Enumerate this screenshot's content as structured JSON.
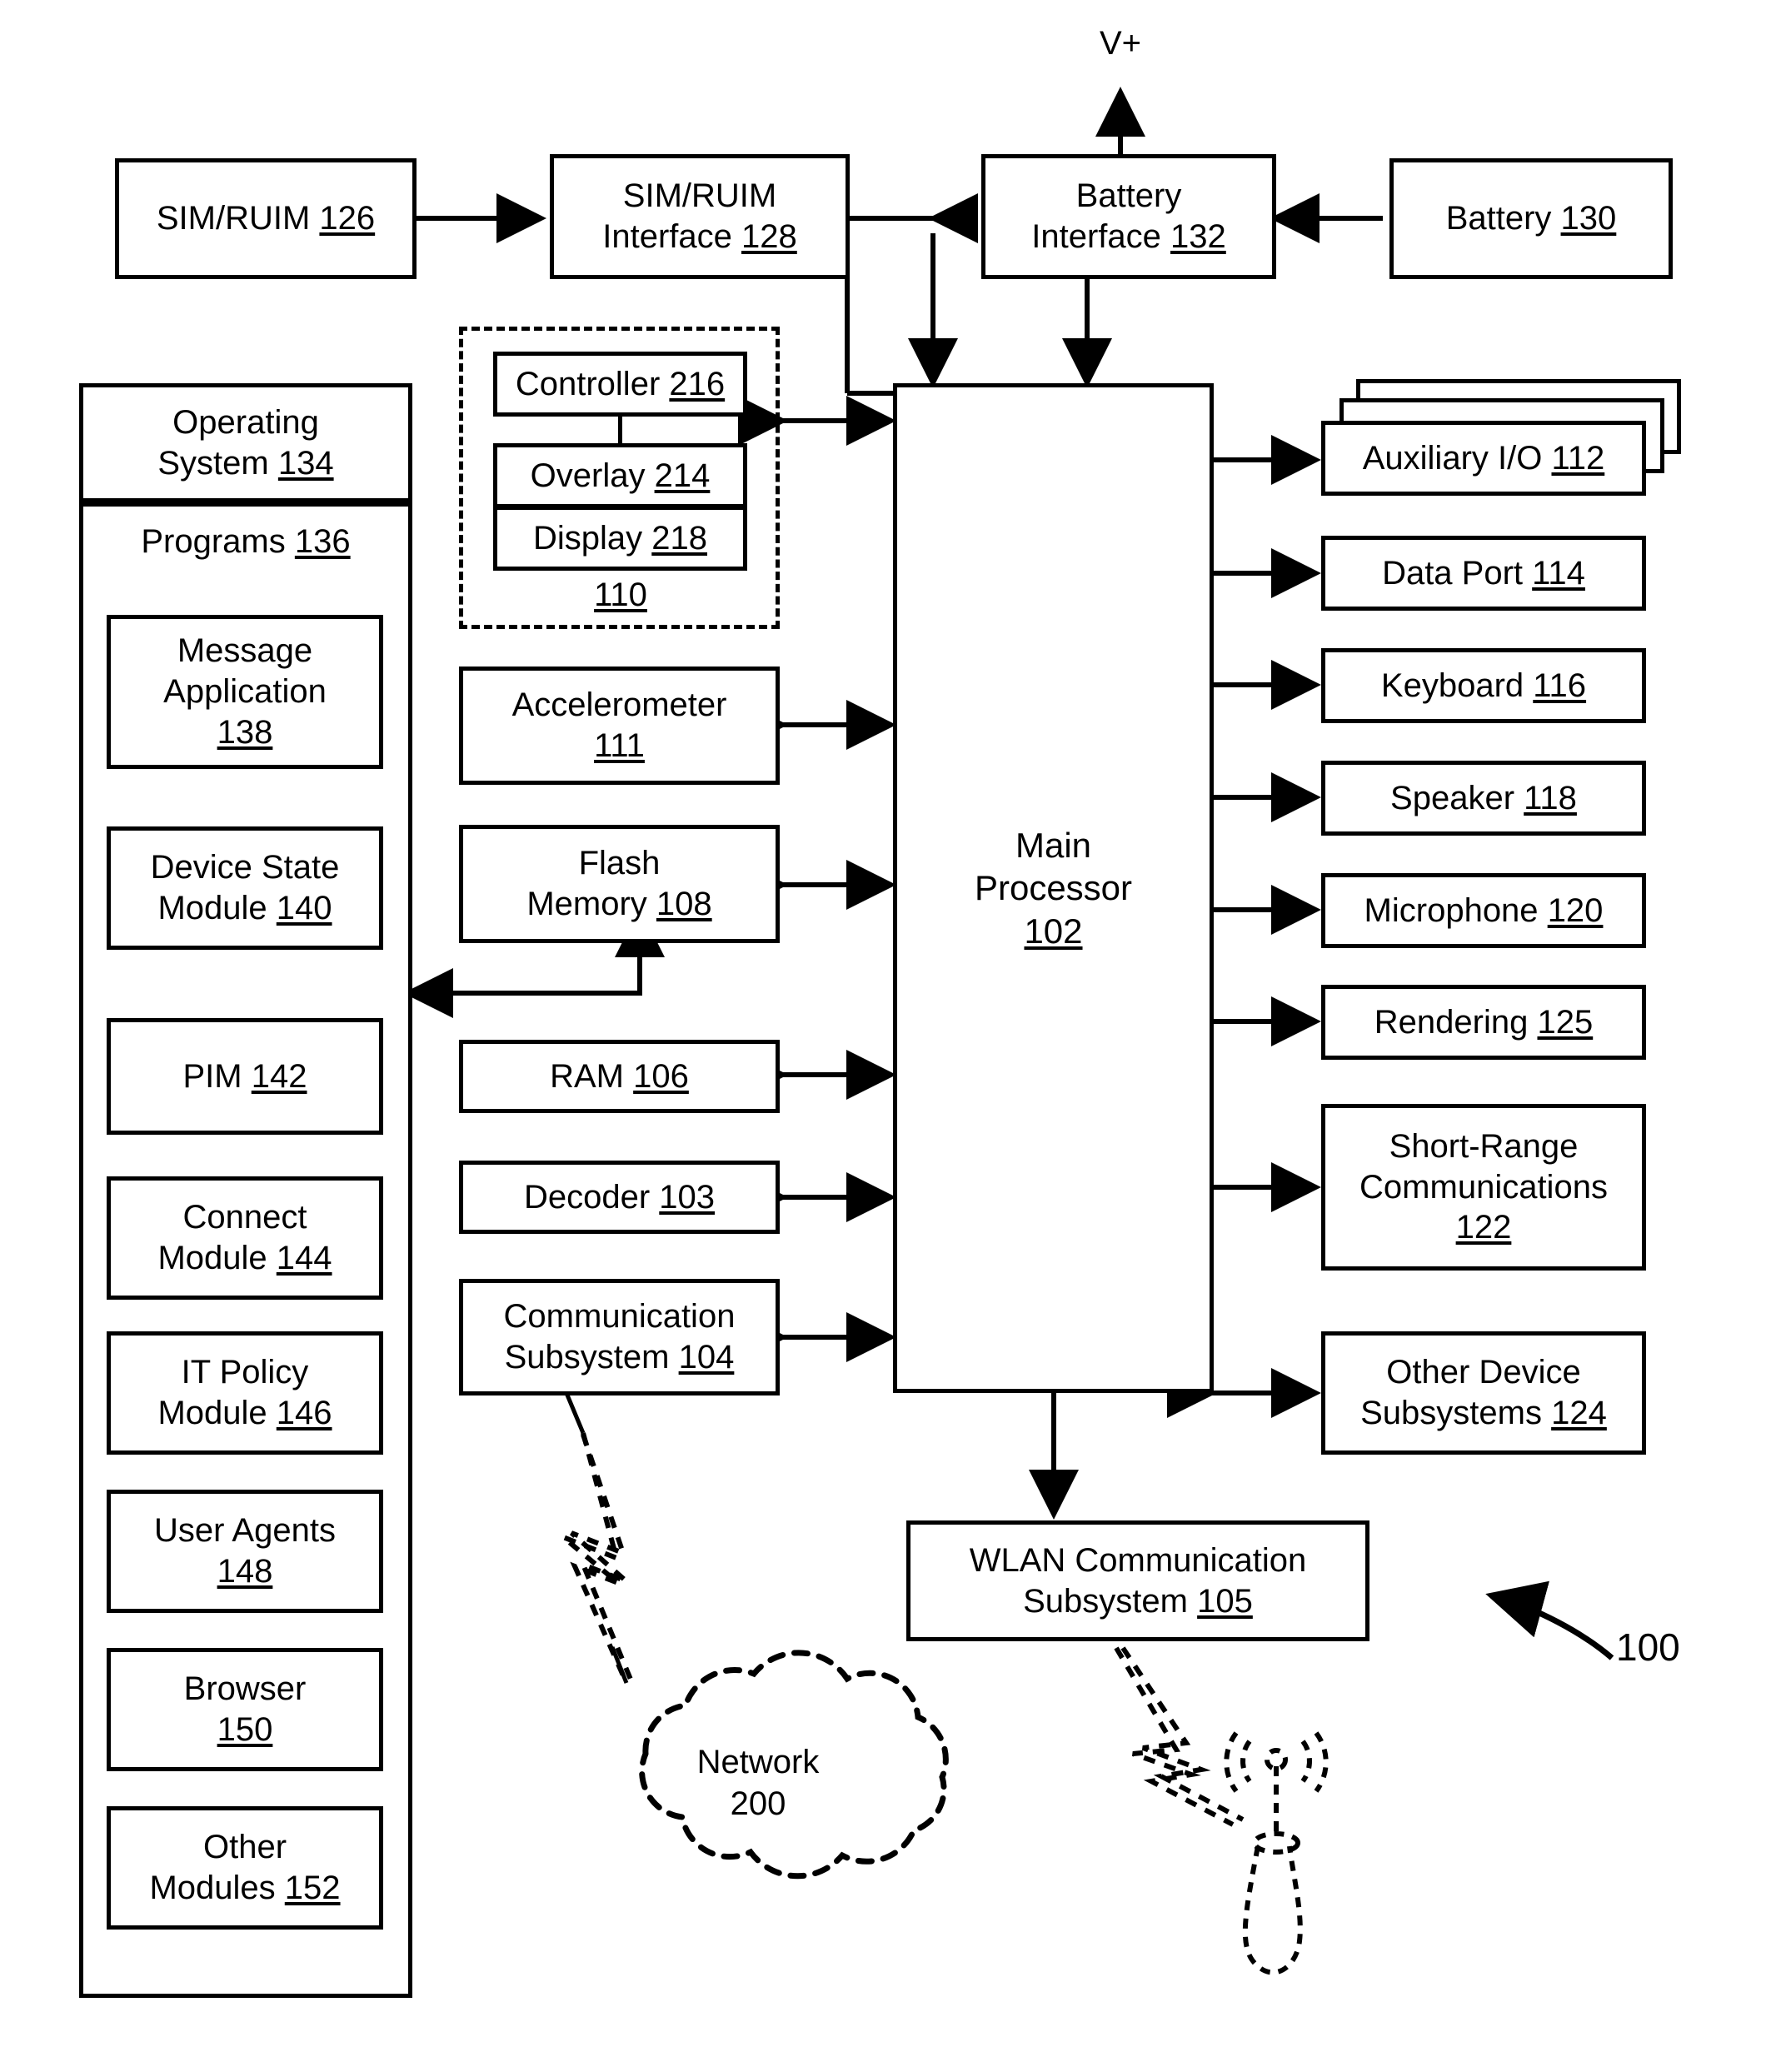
{
  "figure": {
    "reference_numeral": "100",
    "power_label": "V+"
  },
  "top_row": {
    "sim_ruim": {
      "name": "SIM/RUIM",
      "ref": "126"
    },
    "sim_ruim_interface": {
      "name": "SIM/RUIM",
      "name2": "Interface",
      "ref": "128"
    },
    "battery_interface": {
      "name": "Battery",
      "name2": "Interface",
      "ref": "132"
    },
    "battery": {
      "name": "Battery",
      "ref": "130"
    }
  },
  "software_column": {
    "operating_system": {
      "name": "Operating",
      "name2": "System",
      "ref": "134"
    },
    "programs": {
      "name": "Programs",
      "ref": "136"
    },
    "modules": [
      {
        "line1": "Message",
        "line2": "Application",
        "ref": "138",
        "lines": 2
      },
      {
        "line1": "Device State",
        "line2": "Module",
        "ref": "140",
        "lines": 1
      },
      {
        "line1": "PIM",
        "line2": "",
        "ref": "142",
        "lines": 0
      },
      {
        "line1": "Connect",
        "line2": "Module",
        "ref": "144",
        "lines": 1
      },
      {
        "line1": "IT Policy",
        "line2": "Module",
        "ref": "146",
        "lines": 1
      },
      {
        "line1": "User Agents",
        "line2": "",
        "ref": "148",
        "lines": 2
      },
      {
        "line1": "Browser",
        "line2": "",
        "ref": "150",
        "lines": 2
      },
      {
        "line1": "Other",
        "line2": "Modules",
        "ref": "152",
        "lines": 1
      }
    ]
  },
  "display_group": {
    "group_ref": "110",
    "controller": {
      "name": "Controller",
      "ref": "216"
    },
    "overlay": {
      "name": "Overlay",
      "ref": "214"
    },
    "display": {
      "name": "Display",
      "ref": "218"
    }
  },
  "middle_column": {
    "accelerometer": {
      "name": "Accelerometer",
      "ref": "111"
    },
    "flash_memory": {
      "name": "Flash",
      "name2": "Memory",
      "ref": "108"
    },
    "ram": {
      "name": "RAM",
      "ref": "106"
    },
    "decoder": {
      "name": "Decoder",
      "ref": "103"
    },
    "communication_subsystem": {
      "name": "Communication",
      "name2": "Subsystem",
      "ref": "104"
    }
  },
  "processor": {
    "line1": "Main",
    "line2": "Processor",
    "ref": "102"
  },
  "peripherals": [
    {
      "line1": "Auxiliary I/O",
      "line2": "",
      "ref": "112",
      "stacked": true
    },
    {
      "line1": "Data Port",
      "line2": "",
      "ref": "114",
      "stacked": false
    },
    {
      "line1": "Keyboard",
      "line2": "",
      "ref": "116",
      "stacked": false
    },
    {
      "line1": "Speaker",
      "line2": "",
      "ref": "118",
      "stacked": false
    },
    {
      "line1": "Microphone",
      "line2": "",
      "ref": "120",
      "stacked": false
    },
    {
      "line1": "Rendering",
      "line2": "",
      "ref": "125",
      "stacked": false
    },
    {
      "line1": "Short-Range",
      "line2": "Communications",
      "ref": "122",
      "stacked": false
    },
    {
      "line1": "Other Device",
      "line2": "Subsystems",
      "ref": "124",
      "stacked": false
    }
  ],
  "wlan": {
    "name": "WLAN Communication",
    "name2": "Subsystem",
    "ref": "105"
  },
  "network": {
    "name": "Network",
    "ref": "200"
  }
}
